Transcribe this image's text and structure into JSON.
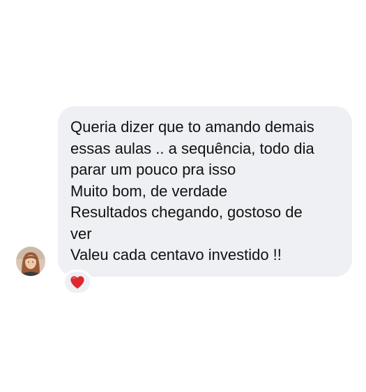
{
  "message": {
    "lines": [
      "Queria dizer que to amando demais",
      "essas aulas .. a sequência, todo dia",
      "parar um pouco pra isso",
      "Muito bom, de verdade",
      "Resultados chegando, gostoso de",
      "ver",
      "Valeu cada centavo investido !!"
    ],
    "reaction_icon": "heart-icon"
  },
  "colors": {
    "bubble_background": "#eef0f3",
    "text": "#111111",
    "heart": "#e0262f"
  }
}
